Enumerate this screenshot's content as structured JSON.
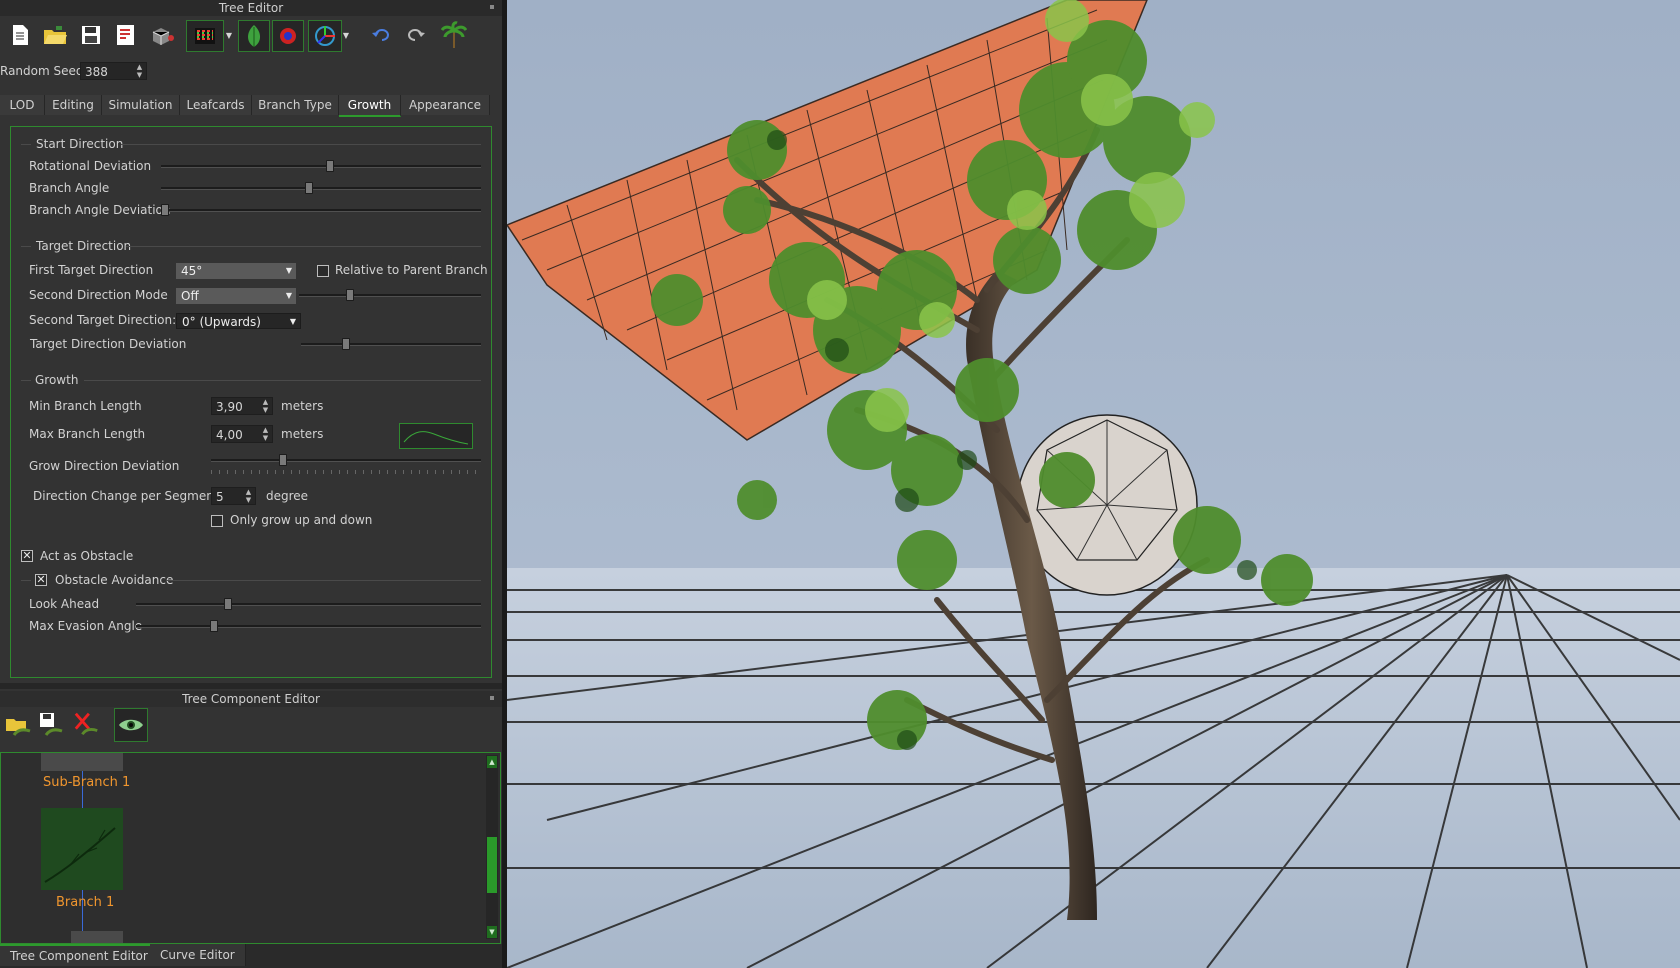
{
  "window": {
    "title": "Tree Editor"
  },
  "toolbar": {
    "buttons": [
      {
        "icon": "new-file-icon"
      },
      {
        "icon": "open-folder-icon"
      },
      {
        "icon": "save-icon"
      },
      {
        "icon": "export-icon"
      },
      {
        "icon": "cube-icon"
      },
      {
        "icon": "colors-icon"
      },
      {
        "icon": "leaf-icon"
      },
      {
        "icon": "target-icon"
      },
      {
        "icon": "transform-gizmo-icon"
      },
      {
        "icon": "undo-icon"
      },
      {
        "icon": "redo-icon"
      },
      {
        "icon": "palm-tree-icon"
      }
    ]
  },
  "seed": {
    "label": "Random Seed",
    "value": "388"
  },
  "tabs": [
    {
      "label": "LOD"
    },
    {
      "label": "Editing"
    },
    {
      "label": "Simulation"
    },
    {
      "label": "Leafcards"
    },
    {
      "label": "Branch Type"
    },
    {
      "label": "Growth",
      "active": true
    },
    {
      "label": "Appearance"
    }
  ],
  "growth": {
    "start_direction": {
      "title": "Start Direction",
      "rotational_deviation": {
        "label": "Rotational Deviation",
        "value": 0.53
      },
      "branch_angle": {
        "label": "Branch Angle",
        "value": 0.46
      },
      "branch_angle_deviation": {
        "label": "Branch Angle Deviation",
        "value": 0.0
      }
    },
    "target_direction": {
      "title": "Target Direction",
      "first_target": {
        "label": "First Target Direction",
        "value": "45°"
      },
      "relative_to_parent": {
        "label": "Relative to Parent Branch",
        "checked": false
      },
      "second_mode": {
        "label": "Second Direction Mode",
        "value": "Off",
        "slider": 0.27
      },
      "second_target": {
        "label": "Second Target Direction:",
        "value": "0° (Upwards)"
      },
      "deviation": {
        "label": "Target Direction Deviation",
        "value": 0.24
      }
    },
    "growth": {
      "title": "Growth",
      "min_branch_length": {
        "label": "Min Branch Length",
        "value": "3,90",
        "unit": "meters"
      },
      "max_branch_length": {
        "label": "Max Branch Length",
        "value": "4,00",
        "unit": "meters"
      },
      "grow_direction_deviation": {
        "label": "Grow Direction Deviation",
        "value": 0.26
      },
      "direction_change": {
        "label": "Direction Change per Segment",
        "value": "5",
        "unit": "degree"
      },
      "only_up_down": {
        "label": "Only grow up and down",
        "checked": false
      }
    },
    "act_as_obstacle": {
      "label": "Act as Obstacle",
      "checked": true
    },
    "obstacle_avoidance": {
      "label": "Obstacle Avoidance",
      "checked": true,
      "look_ahead": {
        "label": "Look Ahead",
        "value": 0.26
      },
      "max_evasion_angle": {
        "label": "Max Evasion Angle",
        "value": 0.22
      }
    }
  },
  "component_editor": {
    "title": "Tree Component Editor",
    "toolbar": [
      {
        "icon": "load-component-icon"
      },
      {
        "icon": "save-component-icon"
      },
      {
        "icon": "delete-component-icon"
      },
      {
        "icon": "visibility-eye-icon"
      }
    ],
    "nodes": [
      {
        "label": "Sub-Branch 1"
      },
      {
        "label": "Branch 1"
      }
    ]
  },
  "bottom_tabs": [
    {
      "label": "Tree Component Editor",
      "active": true
    },
    {
      "label": "Curve Editor"
    }
  ],
  "colors": {
    "accent": "#2d9a2d",
    "node_label": "#f0962e",
    "sky": "#a3b3c8",
    "obstacle_plane": "#e07a52"
  }
}
